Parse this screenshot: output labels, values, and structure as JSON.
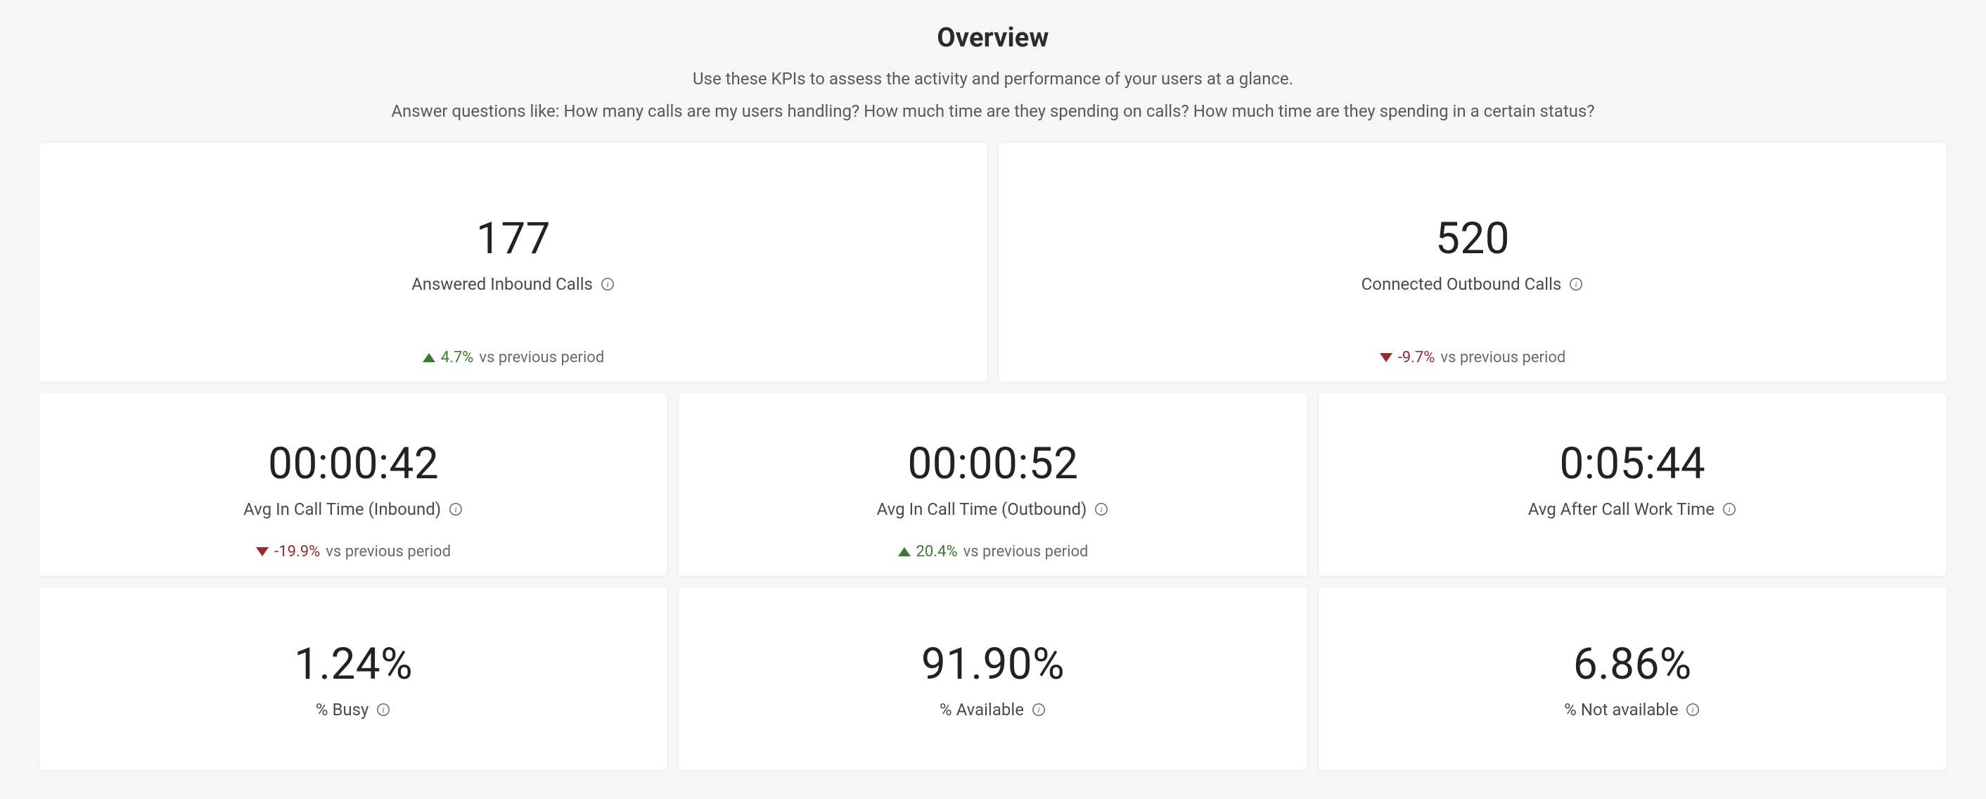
{
  "header": {
    "title": "Overview",
    "subtitle1": "Use these KPIs to assess the activity and performance of your users at a glance.",
    "subtitle2": "Answer questions like: How many calls are my users handling? How much time are they spending on calls? How much time are they spending in a certain status?"
  },
  "common": {
    "vs_previous": "vs previous period"
  },
  "kpi_top": [
    {
      "value": "177",
      "label": "Answered Inbound Calls",
      "trend": {
        "direction": "up",
        "pct": "4.7%"
      }
    },
    {
      "value": "520",
      "label": "Connected Outbound Calls",
      "trend": {
        "direction": "down",
        "pct": "-9.7%"
      }
    }
  ],
  "kpi_mid": [
    {
      "value": "00:00:42",
      "label": "Avg In Call Time (Inbound)",
      "trend": {
        "direction": "down",
        "pct": "-19.9%"
      }
    },
    {
      "value": "00:00:52",
      "label": "Avg In Call Time (Outbound)",
      "trend": {
        "direction": "up",
        "pct": "20.4%"
      }
    },
    {
      "value": "0:05:44",
      "label": "Avg After Call Work Time",
      "trend": null
    }
  ],
  "kpi_bot": [
    {
      "value": "1.24%",
      "label": "% Busy"
    },
    {
      "value": "91.90%",
      "label": "% Available"
    },
    {
      "value": "6.86%",
      "label": "% Not available"
    }
  ]
}
